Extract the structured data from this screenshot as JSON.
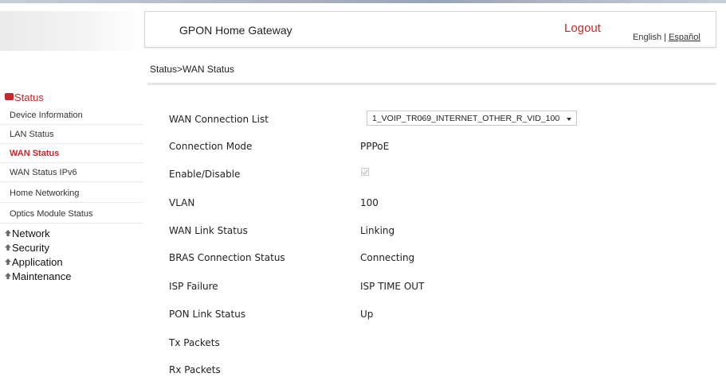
{
  "header": {
    "product_name": "GPON Home Gateway",
    "logout": "Logout",
    "lang_english": "English",
    "lang_sep": "|",
    "lang_espanol": "Español"
  },
  "breadcrumb": "Status>WAN Status",
  "sidebar": {
    "status_title": "Status",
    "status_items": [
      {
        "label": "Device Information",
        "active": false
      },
      {
        "label": "LAN Status",
        "active": false
      },
      {
        "label": "WAN Status",
        "active": true
      },
      {
        "label": "WAN Status IPv6",
        "active": false
      },
      {
        "label": "Home Networking",
        "active": false
      },
      {
        "label": "Optics Module Status",
        "active": false
      }
    ],
    "sections": [
      "Network",
      "Security",
      "Application",
      "Maintenance"
    ]
  },
  "wan": {
    "connection_list_label": "WAN Connection List",
    "connection_list_value": "1_VOIP_TR069_INTERNET_OTHER_R_VID_100",
    "rows": [
      {
        "label": "Connection Mode",
        "value": "PPPoE"
      },
      {
        "label": "Enable/Disable",
        "value": "",
        "checked": true
      },
      {
        "label": "VLAN",
        "value": "100"
      },
      {
        "label": "WAN Link Status",
        "value": "Linking"
      },
      {
        "label": "BRAS Connection Status",
        "value": "Connecting"
      },
      {
        "label": "ISP Failure",
        "value": "ISP TIME OUT"
      },
      {
        "label": "PON Link Status",
        "value": "Up"
      },
      {
        "label": "Tx Packets",
        "value": ""
      },
      {
        "label": "Rx Packets",
        "value": ""
      }
    ]
  },
  "colors": {
    "accent": "#c8282a"
  }
}
